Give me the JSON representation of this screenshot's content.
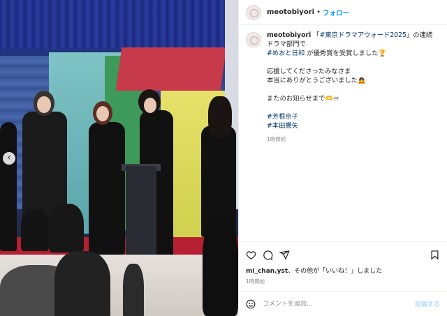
{
  "post": {
    "username": "meotobiyori",
    "follow_label": "フォロー",
    "separator": "•"
  },
  "caption": {
    "username": "meotobiyori",
    "line1_prefix": "「",
    "line1_tag": "#東京ドラマアウォード2025",
    "line1_suffix": "」の連続ドラマ部門で",
    "line2_tag": "#めおと日和",
    "line2_suffix": "が優秀賞を受賞しました🏆",
    "line3": "応援してくださったみなさま",
    "line4": "本当にありがとうございました🙇",
    "line5": "またのお知らせまで🫶♾",
    "tag1": "#芳根京子",
    "tag2": "#本田響矢",
    "time": "1時間前"
  },
  "actions": {
    "liker": "mi_chan.yst",
    "likes_suffix": "、その他が「いいね！」しました",
    "time": "1時間前"
  },
  "comment_box": {
    "placeholder": "コメントを追加...",
    "post_label": "投稿する"
  },
  "photo": {
    "prev_chevron": "‹"
  }
}
